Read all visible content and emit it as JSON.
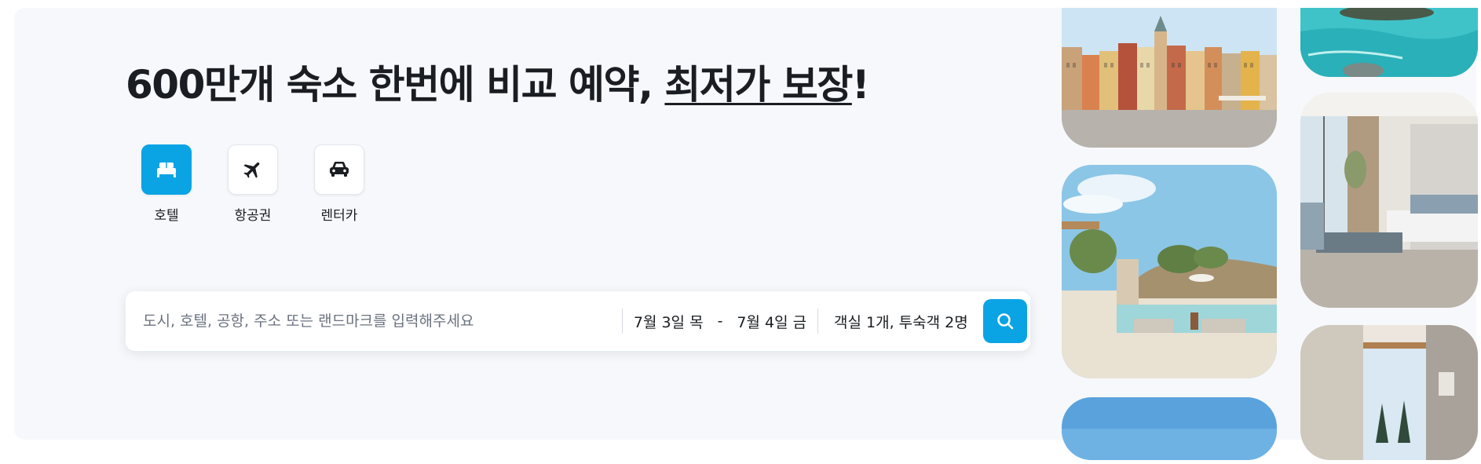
{
  "headline": {
    "text_plain": "600만개 숙소 한번에 비교 예약, ",
    "text_underlined": "최저가 보장",
    "text_end": "!"
  },
  "categories": [
    {
      "label": "호텔",
      "icon": "bed-icon",
      "active": true
    },
    {
      "label": "항공권",
      "icon": "airplane-icon",
      "active": false
    },
    {
      "label": "렌터카",
      "icon": "car-icon",
      "active": false
    }
  ],
  "search": {
    "placeholder": "도시, 호텔, 공항, 주소 또는 랜드마크를 입력해주세요",
    "value": "",
    "checkin": "7월 3일 목",
    "separator": "-",
    "checkout": "7월 4일 금",
    "guests": "객실 1개, 투숙객 2명",
    "button_icon": "search-icon"
  },
  "gallery": [
    {
      "name": "old-town-square-photo"
    },
    {
      "name": "resort-pool-photo"
    },
    {
      "name": "blue-sky-photo"
    },
    {
      "name": "turquoise-sea-photo"
    },
    {
      "name": "hotel-bedroom-photo"
    },
    {
      "name": "snowy-window-photo"
    }
  ],
  "colors": {
    "accent": "#0aa4e5",
    "hero_background": "#f6f8fb",
    "text": "#1a1d21",
    "placeholder": "#6b7280"
  }
}
